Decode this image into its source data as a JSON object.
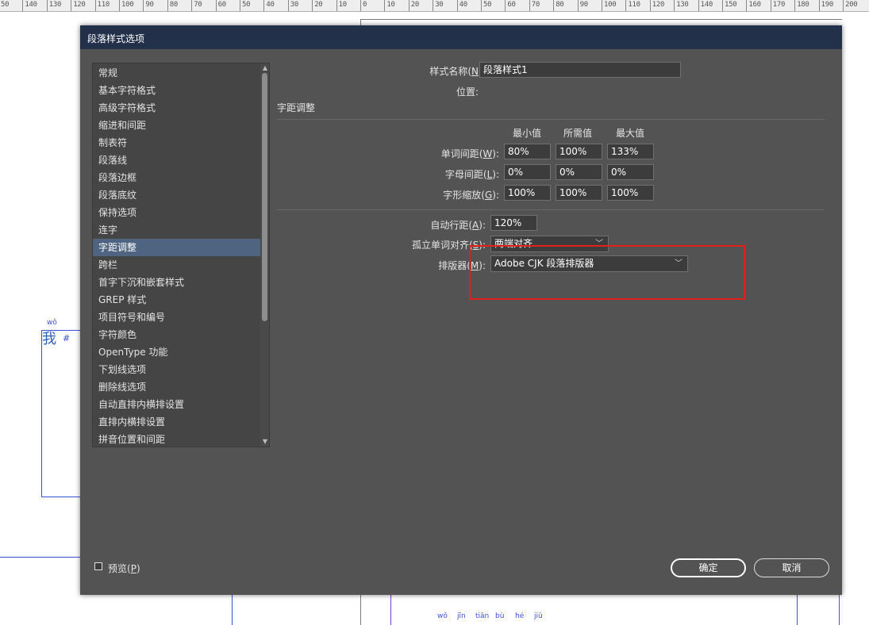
{
  "ruler": {
    "ticks": [
      "50",
      "140",
      "130",
      "120",
      "110",
      "100",
      "90",
      "80",
      "70",
      "60",
      "50",
      "40",
      "30",
      "20",
      "10",
      "0",
      "10",
      "20",
      "30",
      "40",
      "50",
      "60",
      "70",
      "80",
      "90",
      "100",
      "110",
      "120",
      "130",
      "140",
      "150",
      "160",
      "170",
      "180",
      "190",
      "200"
    ]
  },
  "background": {
    "ruby_wo": "wǒ",
    "char_wo": "我",
    "hash_mark": "#",
    "pinyin": [
      "wǒ",
      "jīn",
      "tiān",
      "bù",
      "hé",
      "jiǔ"
    ]
  },
  "dialog": {
    "title": "段落样式选项",
    "categories": [
      "常规",
      "基本字符格式",
      "高级字符格式",
      "缩进和间距",
      "制表符",
      "段落线",
      "段落边框",
      "段落底纹",
      "保持选项",
      "连字",
      "字距调整",
      "跨栏",
      "首字下沉和嵌套样式",
      "GREP 样式",
      "项目符号和编号",
      "字符颜色",
      "OpenType 功能",
      "下划线选项",
      "删除线选项",
      "自动直排内横排设置",
      "直排内横排设置",
      "拼音位置和间距"
    ],
    "selected_category": "字距调整",
    "style_name_label": "样式名称(",
    "style_name_key": "N",
    "style_name_label_end": "):",
    "style_name_value": "段落样式1",
    "location_label": "位置:",
    "section_title": "字距调整",
    "columns": [
      "最小值",
      "所需值",
      "最大值"
    ],
    "rows": [
      {
        "label": "单词间距(",
        "key": "W",
        "end": "):",
        "values": [
          "80%",
          "100%",
          "133%"
        ]
      },
      {
        "label": "字母间距(",
        "key": "L",
        "end": "):",
        "values": [
          "0%",
          "0%",
          "0%"
        ]
      },
      {
        "label": "字形缩放(",
        "key": "G",
        "end": "):",
        "values": [
          "100%",
          "100%",
          "100%"
        ]
      }
    ],
    "auto_leading_label": "自动行距(",
    "auto_leading_key": "A",
    "auto_leading_end": "):",
    "auto_leading_value": "120%",
    "single_word_label": "孤立单词对齐(",
    "single_word_key": "S",
    "single_word_end": "):",
    "single_word_value": "两端对齐",
    "composer_label": "排版器(",
    "composer_key": "M",
    "composer_end": "):",
    "composer_value": "Adobe CJK 段落排版器",
    "preview_label": "预览(",
    "preview_key": "P",
    "preview_end": ")",
    "preview_checked": false,
    "ok_label": "确定",
    "cancel_label": "取消"
  },
  "colors": {
    "dialog_bg": "#535353",
    "titlebar_bg": "#22304a",
    "selected_item": "#4e6480",
    "highlight_box": "#e0201b",
    "guide_blue": "#3d4fd6"
  }
}
